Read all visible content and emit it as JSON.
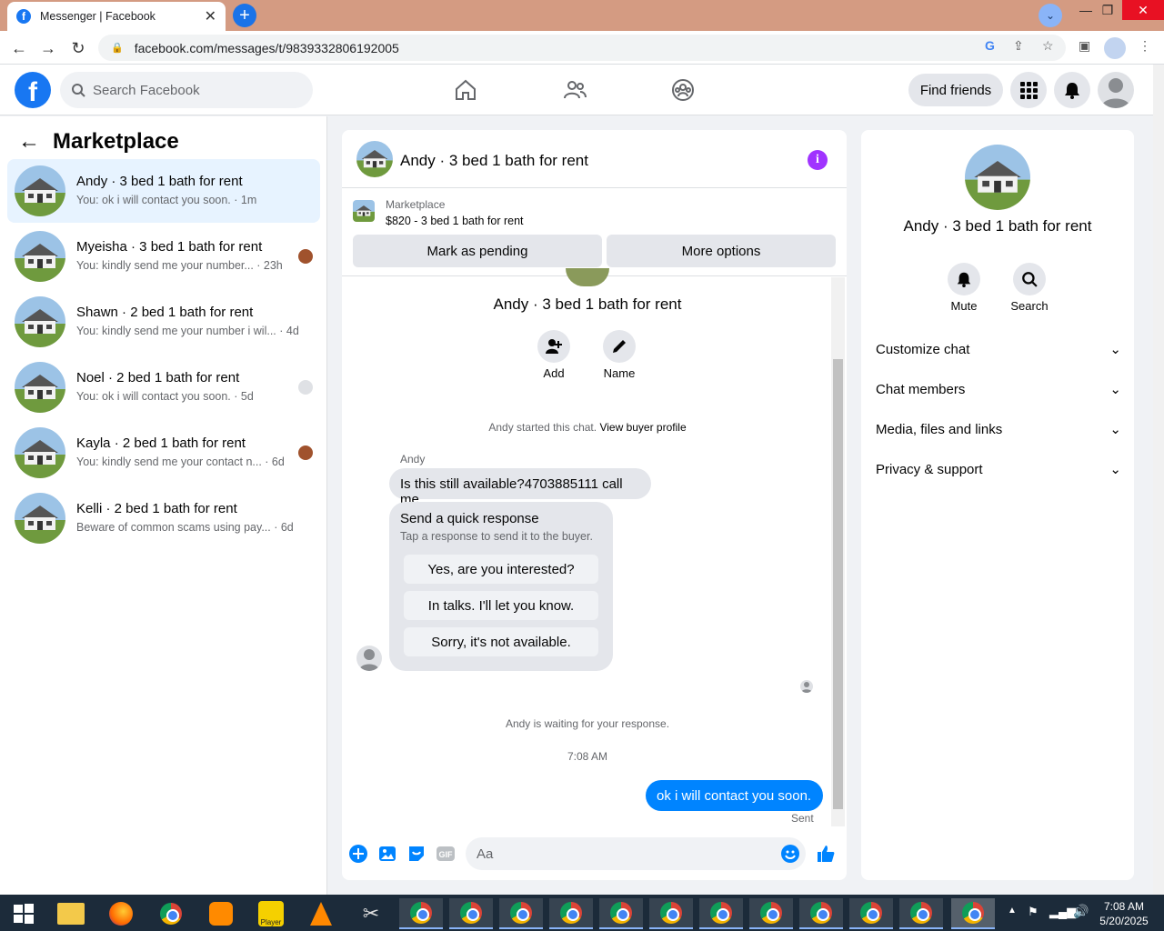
{
  "browser": {
    "tab_title": "Messenger | Facebook",
    "url": "facebook.com/messages/t/9839332806192005"
  },
  "fbnav": {
    "search_placeholder": "Search Facebook",
    "find_friends": "Find friends"
  },
  "left": {
    "heading": "Marketplace",
    "conversations": [
      {
        "name": "Andy · 3 bed 1 bath for rent",
        "preview": "You: ok i will contact you soon. · 1m",
        "active": true
      },
      {
        "name": "Myeisha · 3 bed 1 bath for rent",
        "preview": "You: kindly send me your number... · 23h"
      },
      {
        "name": "Shawn · 2 bed 1 bath for rent",
        "preview": "You: kindly send me your number i wil... · 4d"
      },
      {
        "name": "Noel · 2 bed 1 bath for rent",
        "preview": "You: ok i will contact you soon. · 5d"
      },
      {
        "name": "Kayla · 2 bed 1 bath for rent",
        "preview": "You: kindly send me your contact n... · 6d"
      },
      {
        "name": "Kelli · 2 bed 1 bath for rent",
        "preview": "Beware of common scams using pay... · 6d"
      }
    ]
  },
  "chat": {
    "title": "Andy · 3 bed 1 bath for rent",
    "marketplace_label": "Marketplace",
    "listing": "$820 - 3 bed 1 bath for rent",
    "mark_pending": "Mark as pending",
    "more_options": "More options",
    "profile_name": "Andy · 3 bed 1 bath for rent",
    "add_label": "Add",
    "name_label": "Name",
    "started_text": "Andy started this chat.",
    "view_profile": "View buyer profile",
    "sender": "Andy",
    "incoming_msg": "Is this still available?4703885111 call me",
    "quick_title": "Send a quick response",
    "quick_sub": "Tap a response to send it to the buyer.",
    "quick_replies": [
      "Yes, are you interested?",
      "In talks. I'll let you know.",
      "Sorry, it's not available."
    ],
    "waiting_text": "Andy is waiting for your response.",
    "time": "7:08 AM",
    "outgoing_msg": "ok i will contact you soon.",
    "sent_label": "Sent",
    "input_placeholder": "Aa"
  },
  "right": {
    "name": "Andy · 3 bed 1 bath for rent",
    "mute": "Mute",
    "search": "Search",
    "rows": [
      "Customize chat",
      "Chat members",
      "Media, files and links",
      "Privacy & support"
    ]
  },
  "taskbar": {
    "time": "7:08 AM",
    "date": "5/20/2025",
    "player_label": "Player"
  },
  "colors": {
    "brand": "#1877f2",
    "outgoing_bubble": "#0084ff",
    "info_icon": "#a033ff"
  }
}
